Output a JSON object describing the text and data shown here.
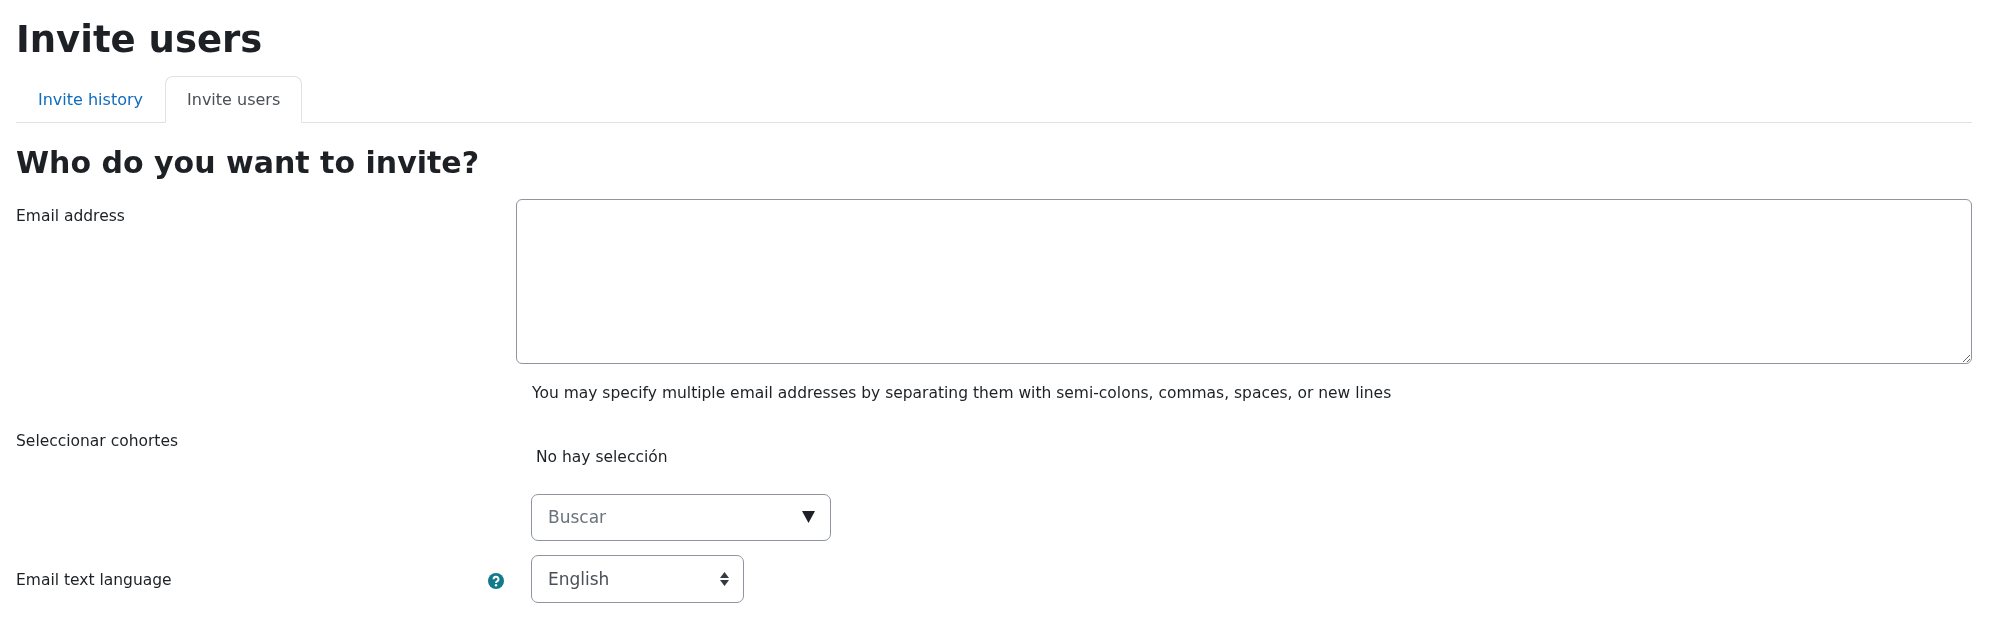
{
  "page_title": "Invite users",
  "tabs": [
    {
      "label": "Invite history",
      "selected": false
    },
    {
      "label": "Invite users",
      "selected": true
    }
  ],
  "section_heading": "Who do you want to invite?",
  "fields": [
    {
      "kind": "textarea",
      "label": "Email address",
      "help_text": "You may specify multiple email addresses by separating them with semi-colons, commas, spaces, or new lines"
    },
    {
      "kind": "autocomplete",
      "label": "Seleccionar cohortes",
      "selection": "No hay selección",
      "placeholder": "Buscar"
    },
    {
      "kind": "select",
      "label": "Email text language",
      "help_icon": true,
      "value": "English"
    }
  ]
}
